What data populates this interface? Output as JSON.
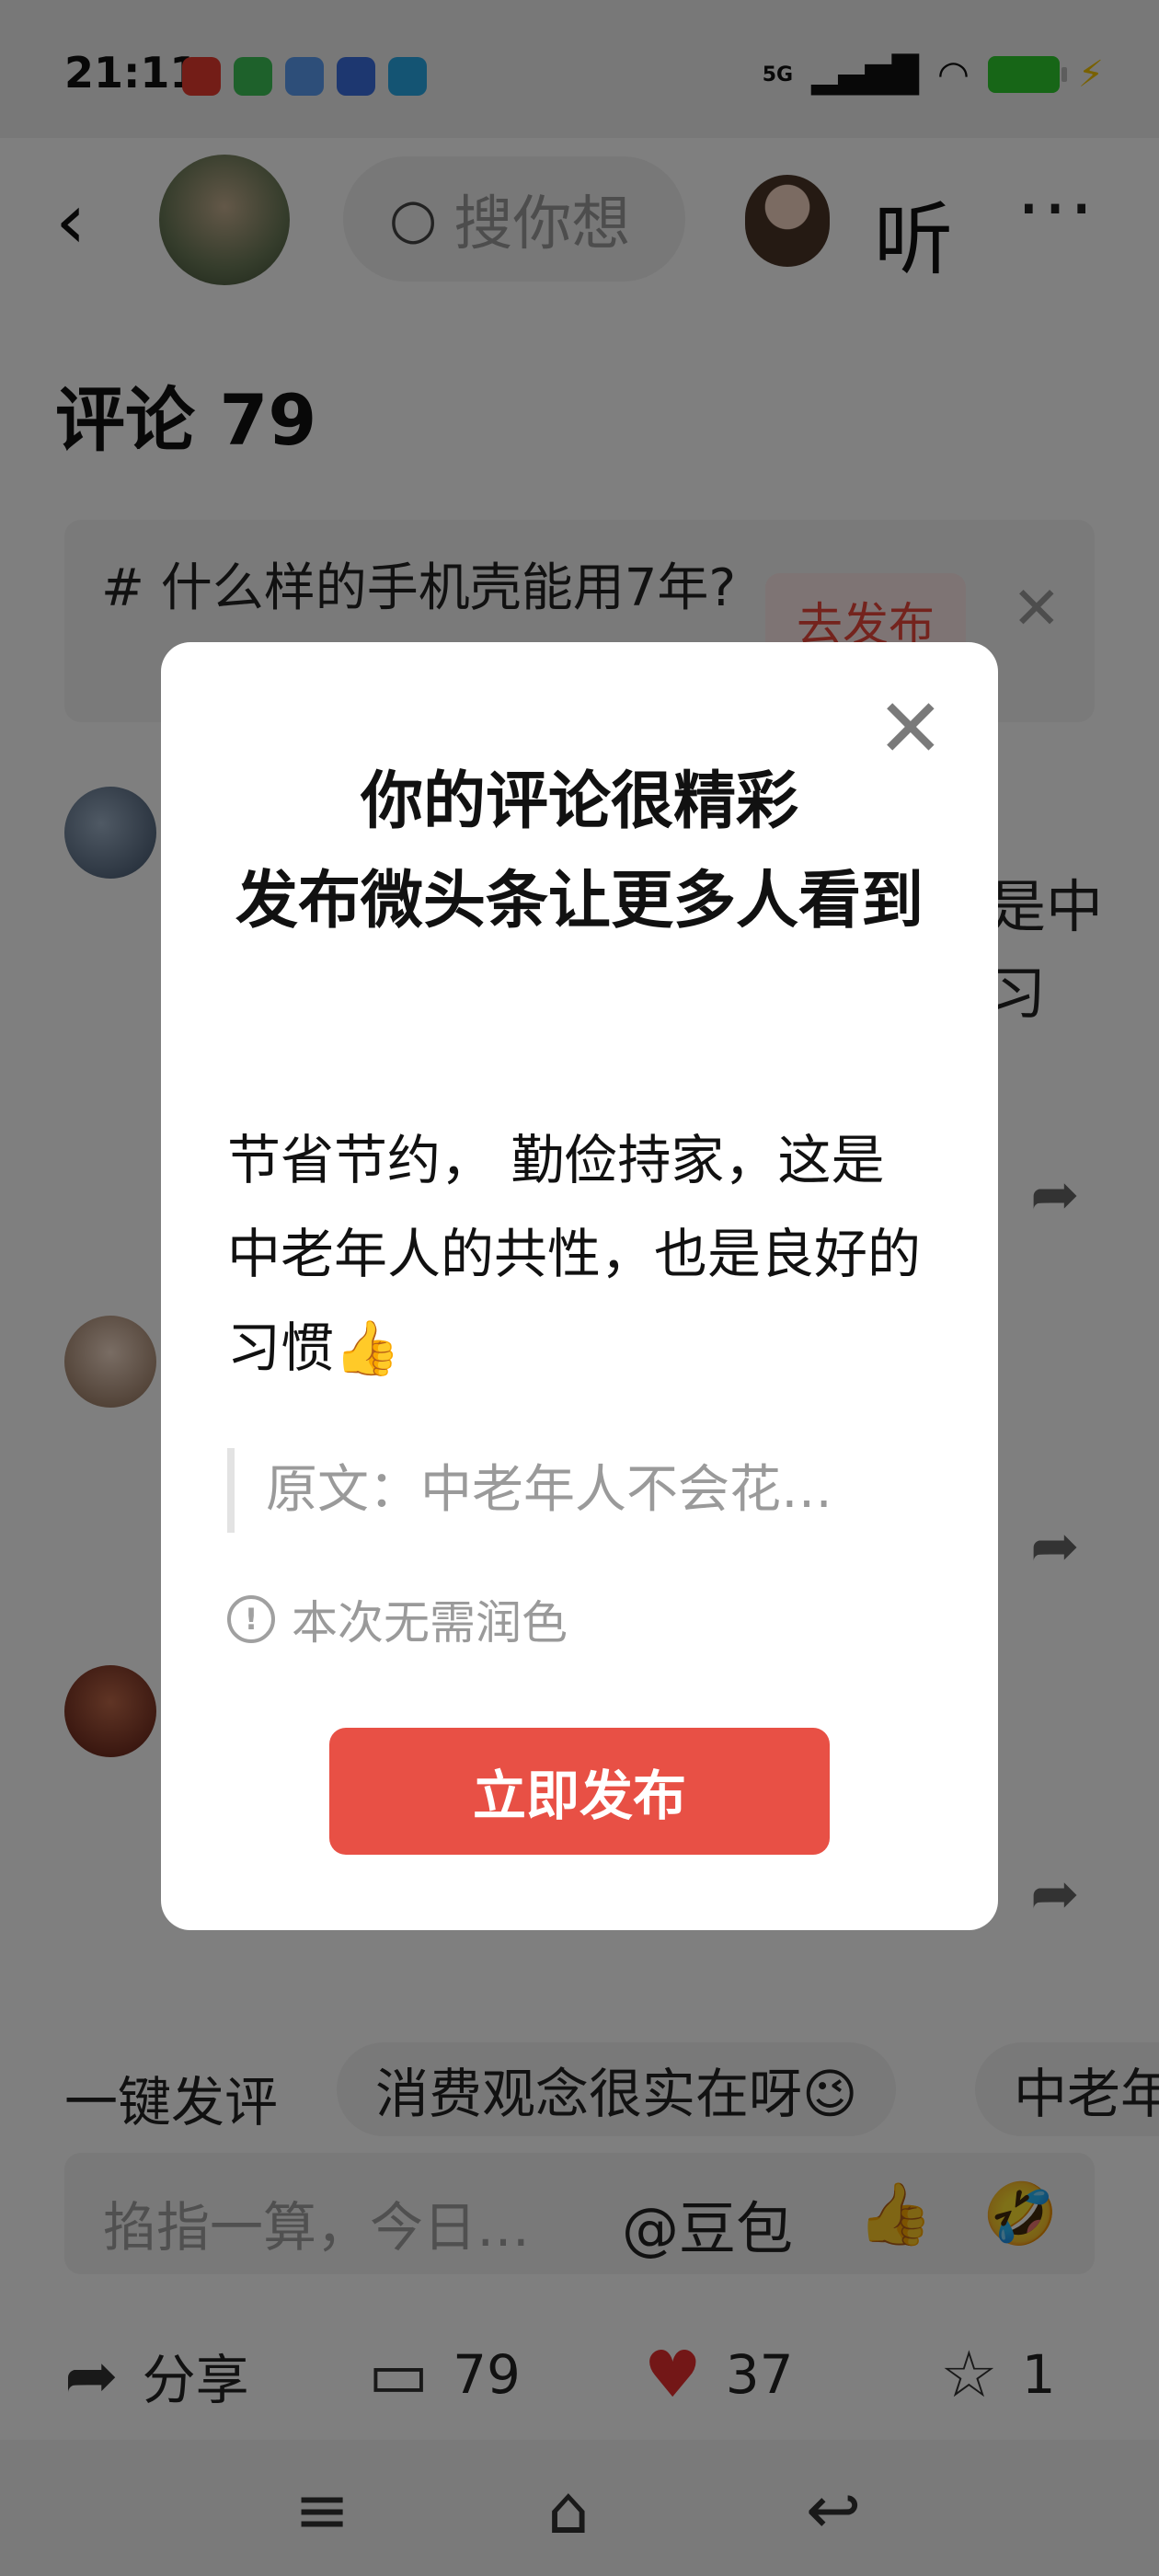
{
  "status_bar": {
    "time": "21:11",
    "network": "5G",
    "notification_icons": [
      "toutiao-icon",
      "phone-icon",
      "cloud-icon",
      "baidu-icon",
      "app-icon"
    ],
    "battery_color": "#2ecc2e"
  },
  "header": {
    "back_icon": "chevron-left-icon",
    "search_placeholder": "搜你想",
    "listen_label": "听",
    "more_icon": "more-horizontal-icon"
  },
  "comments": {
    "title": "评论 79",
    "topic_text": "什么样的手机壳能用7年?",
    "topic_publish_label": "去发布",
    "fragments": [
      "是中",
      "习"
    ]
  },
  "quick_replies": {
    "label": "一键发评",
    "chips": [
      "消费观念很实在呀😉",
      "中老年"
    ]
  },
  "input_bar": {
    "placeholder": "掐指一算，今日…",
    "mention": "@豆包",
    "emojis": [
      "👍",
      "🤣"
    ]
  },
  "bottom_actions": {
    "share_label": "分享",
    "comment_count": "79",
    "like_count": "37",
    "favorite_count": "1"
  },
  "dialog": {
    "title_line1": "你的评论很精彩",
    "title_line2": "发布微头条让更多人看到",
    "body": "节省节约， 勤俭持家，这是中老年人的共性，也是良好的习惯👍",
    "original_quote": "原文：中老年人不会花…",
    "note": "本次无需润色",
    "publish_button": "立即发布"
  },
  "colors": {
    "accent_red": "#e85045",
    "like_red": "#e62e2e",
    "overlay": "rgba(0,0,0,0.5)"
  }
}
